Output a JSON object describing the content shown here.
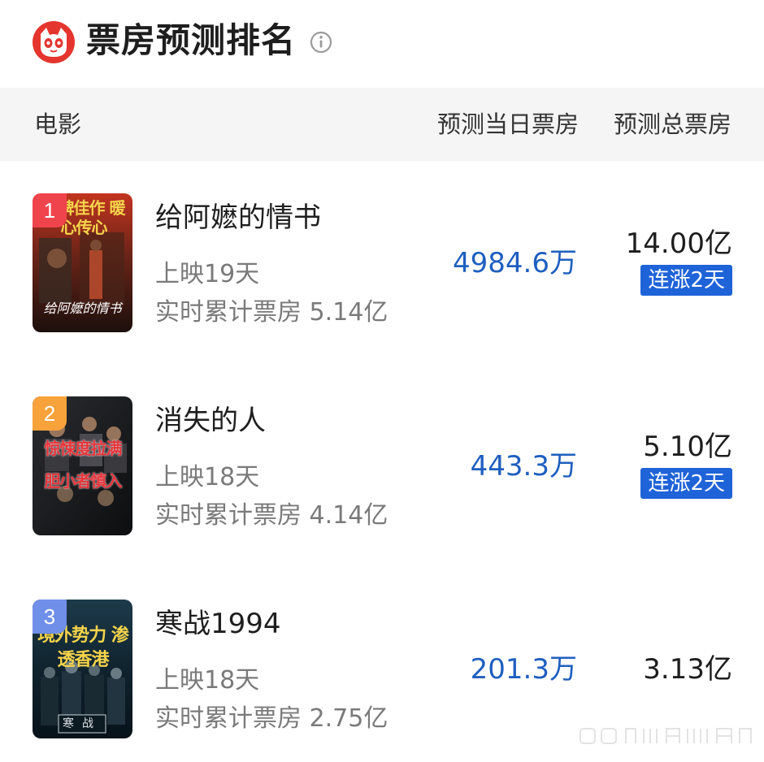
{
  "header": {
    "title": "票房预测排名",
    "logo_icon": "cat-eye-logo-icon",
    "info_icon": "info-circle-icon",
    "brand_color": "#e5352f"
  },
  "columns": {
    "movie": "电影",
    "daily": "预测当日票房",
    "total": "预测总票房"
  },
  "movies": [
    {
      "rank": "1",
      "rank_color": "#f0444c",
      "title": "给阿嬷的情书",
      "days": "上映19天",
      "cumulative": "实时累计票房 5.14亿",
      "daily_forecast": "4984.6万",
      "total_forecast": "14.00亿",
      "trend": "连涨2天",
      "poster_text": "口碑佳作 暖心传心",
      "poster_title": "给阿嬷的情书"
    },
    {
      "rank": "2",
      "rank_color": "#f7a23b",
      "title": "消失的人",
      "days": "上映18天",
      "cumulative": "实时累计票房 4.14亿",
      "daily_forecast": "443.3万",
      "total_forecast": "5.10亿",
      "trend": "连涨2天",
      "poster_text": "惊悚度拉满 胆小者慎入"
    },
    {
      "rank": "3",
      "rank_color": "#6f8fe8",
      "title": "寒战1994",
      "days": "上映18天",
      "cumulative": "实时累计票房 2.75亿",
      "daily_forecast": "201.3万",
      "total_forecast": "3.13亿",
      "trend": "",
      "poster_text": "境外势力 渗透香港",
      "poster_title": "寒战"
    }
  ],
  "colors": {
    "accent_blue": "#1f5fbf",
    "trend_badge_blue": "#1f63d8",
    "header_bar_bg": "#f5f5f5"
  }
}
